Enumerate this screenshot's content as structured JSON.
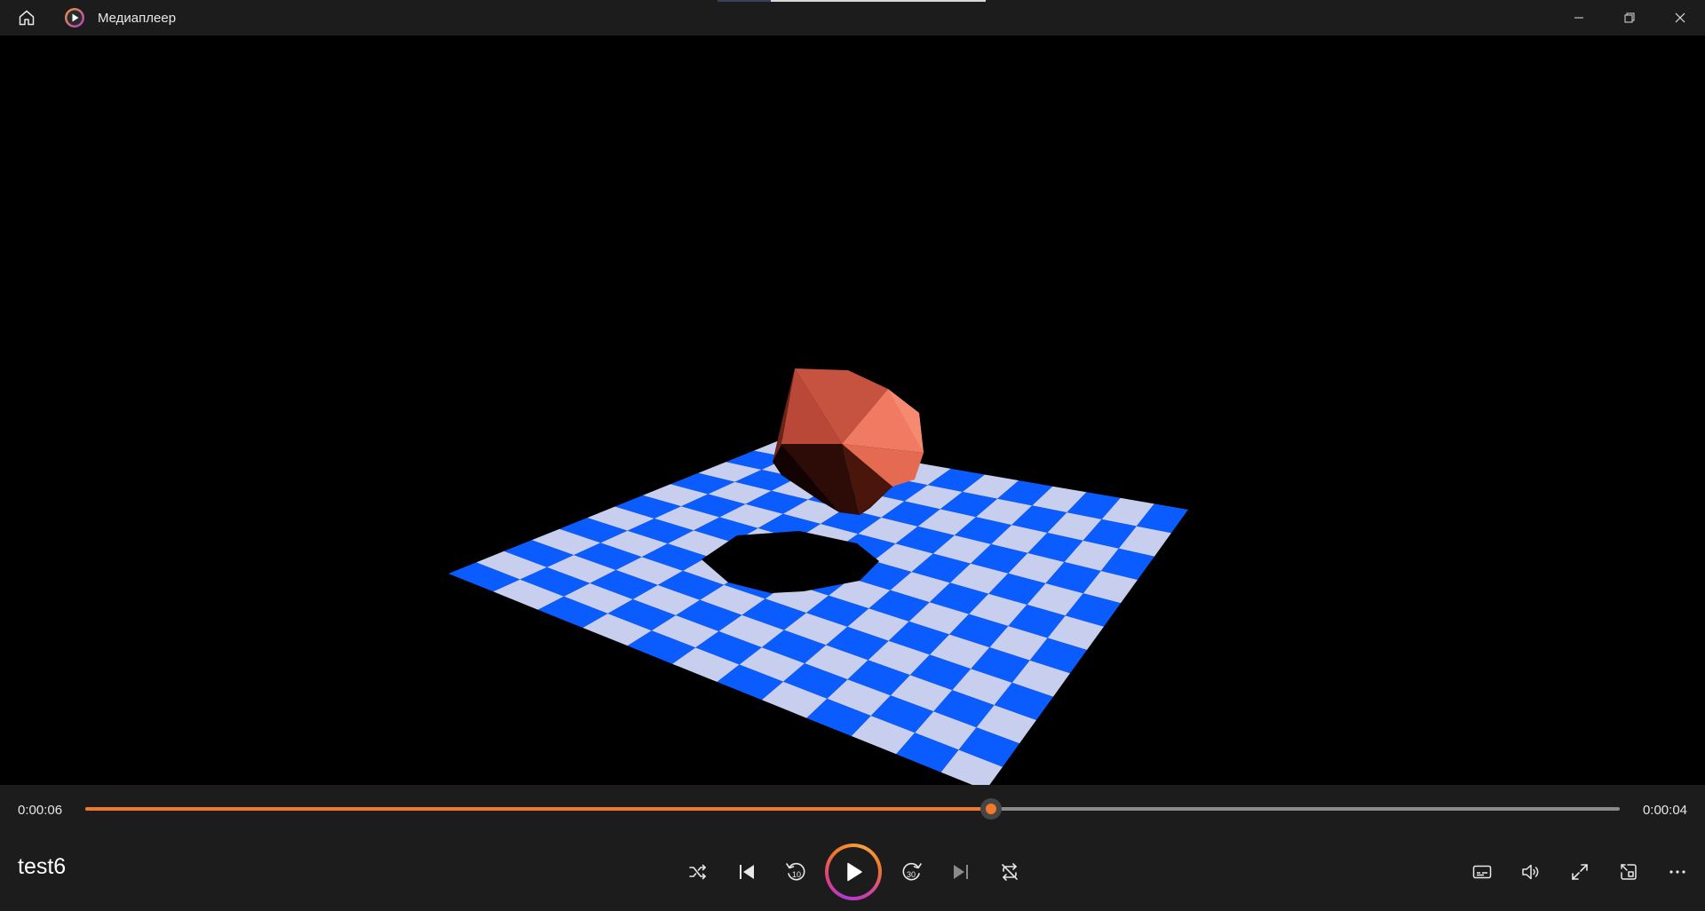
{
  "app": {
    "title": "Медиаплеер",
    "icons": {
      "home": "home-icon",
      "app": "media-player-logo-icon"
    },
    "window_controls": [
      "minimize-icon",
      "restore-icon",
      "close-icon"
    ]
  },
  "player": {
    "elapsed": "0:00:06",
    "remaining": "0:00:04",
    "progress": 0.59,
    "media_title": "test6",
    "accent_color": "#f07a2a",
    "controls": [
      "shuffle-icon",
      "previous-icon",
      "skip-back-10-icon",
      "play-icon",
      "skip-forward-30-icon",
      "next-icon",
      "repeat-icon"
    ],
    "skip_back_label": "10",
    "skip_forward_label": "30",
    "right_controls": [
      "subtitles-icon",
      "volume-icon",
      "fullscreen-icon",
      "mini-player-icon",
      "more-icon"
    ]
  },
  "video": {
    "scene": "checkerboard-floor-with-red-polyhedral-sphere",
    "colors": {
      "floor_blue": "#0a5cff",
      "floor_light": "#c8cfee",
      "sphere": "#e06048",
      "background": "#000000"
    }
  }
}
